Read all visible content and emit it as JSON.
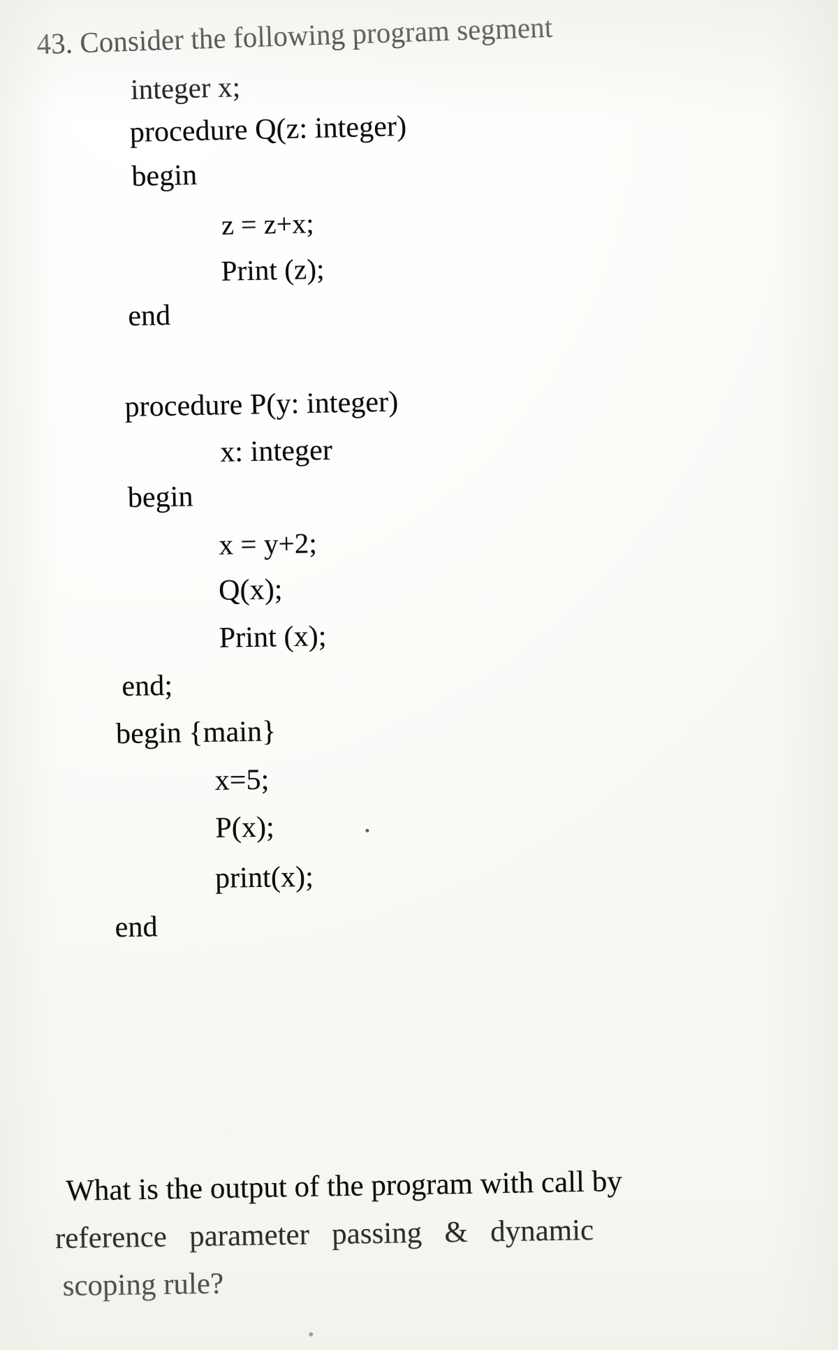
{
  "document": {
    "question_number": "43.",
    "prompt": "Consider the following program segment",
    "heading_full": "43. Consider the following program segment",
    "code_lines": [
      {
        "text": "integer x;",
        "indent": 1
      },
      {
        "text": "procedure Q(z: integer)",
        "indent": 1
      },
      {
        "text": "begin",
        "indent": 1
      },
      {
        "text": "z = z+x;",
        "indent": 3
      },
      {
        "text": "Print (z);",
        "indent": 3
      },
      {
        "text": "end",
        "indent": 0
      },
      {
        "text": "",
        "indent": 0
      },
      {
        "text": "procedure P(y: integer)",
        "indent": 1
      },
      {
        "text": "x: integer",
        "indent": 3
      },
      {
        "text": "begin",
        "indent": 1
      },
      {
        "text": "x = y+2;",
        "indent": 3
      },
      {
        "text": "Q(x);",
        "indent": 3
      },
      {
        "text": "Print (x);",
        "indent": 3
      },
      {
        "text": "end;",
        "indent": 1
      },
      {
        "text": "begin {main}",
        "indent": 1
      },
      {
        "text": "x=5;",
        "indent": 3
      },
      {
        "text": "P(x);",
        "indent": 3
      },
      {
        "text": "print(x);",
        "indent": 3
      },
      {
        "text": "end",
        "indent": 0
      }
    ],
    "question_lines": [
      "What is the output of the program with call by",
      "reference   parameter   passing   &   dynamic",
      "scoping rule?"
    ],
    "question_full": "What is the output of the program with call by reference parameter passing & dynamic scoping rule?"
  }
}
